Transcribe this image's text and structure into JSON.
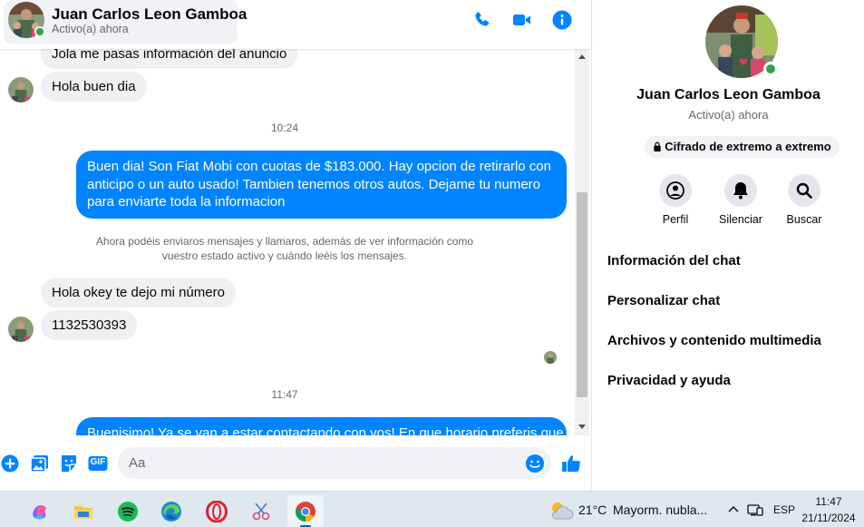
{
  "header": {
    "contact_name": "Juan Carlos Leon Gamboa",
    "contact_status": "Activo(a) ahora",
    "icons": [
      "phone-icon",
      "video-camera-icon",
      "info-icon"
    ]
  },
  "messages": {
    "partial_top": "Jola me pasas información del anuncio",
    "incoming_1": "Hola buen dia",
    "time_1": "10:24",
    "outgoing_1": "Buen dia! Son Fiat Mobi con cuotas de $183.000. Hay opcion de retirarlo con anticipo o un auto usado! Tambien tenemos otros autos. Dejame tu numero para enviarte toda la informacion",
    "system_note": "Ahora podéis enviaros mensajes y llamaros, además de ver información como vuestro estado activo y cuándo leéis los mensajes.",
    "incoming_2": "Hola okey te dejo mi número",
    "incoming_3": "1132530393",
    "time_2": "11:47",
    "outgoing_2_partial": "Buenisimo! Ya se van a estar contactando con vos! En que horario preferis que"
  },
  "composer": {
    "placeholder": "Aa",
    "icons": [
      "plus-icon",
      "photo-icon",
      "sticker-icon",
      "gif-icon",
      "emoji-icon",
      "thumbs-up-icon"
    ],
    "gif_label": "GIF"
  },
  "info_panel": {
    "name": "Juan Carlos Leon Gamboa",
    "status": "Activo(a) ahora",
    "encryption": "Cifrado de extremo a extremo",
    "actions": [
      {
        "label": "Perfil",
        "icon": "profile-icon"
      },
      {
        "label": "Silenciar",
        "icon": "bell-icon"
      },
      {
        "label": "Buscar",
        "icon": "search-icon"
      }
    ],
    "menu": [
      "Información del chat",
      "Personalizar chat",
      "Archivos y contenido multimedia",
      "Privacidad y ayuda"
    ]
  },
  "taskbar": {
    "apps": [
      "copilot-icon",
      "file-explorer-icon",
      "spotify-icon",
      "edge-icon",
      "opera-icon",
      "snipping-tool-icon",
      "chrome-icon"
    ],
    "weather_temp": "21°C",
    "weather_desc": "Mayorm. nubla...",
    "language": "ESP",
    "time": "11:47",
    "date": "21/11/2024"
  },
  "colors": {
    "messenger_blue": "#0084ff",
    "incoming_bubble": "#f0f0f0",
    "online_green": "#31a24c",
    "secondary_text": "#65676b"
  }
}
